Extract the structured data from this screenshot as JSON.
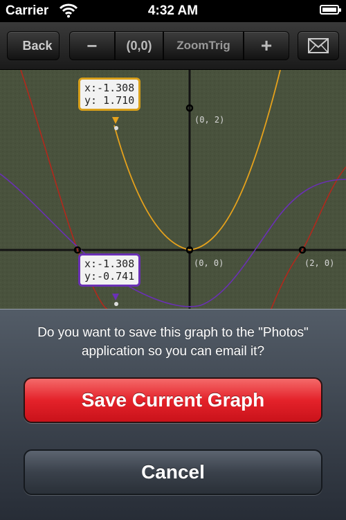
{
  "status_bar": {
    "carrier": "Carrier",
    "time": "4:32 AM"
  },
  "toolbar": {
    "back_label": "Back",
    "zoom_out_label": "−",
    "origin_label": "(0,0)",
    "zoom_trig_label": "ZoomTrig",
    "zoom_in_label": "+",
    "mail_icon": "envelope-icon"
  },
  "graph": {
    "point_labels": {
      "top": "(0, 2)",
      "origin": "(0, 0)",
      "right": "(2, 0)"
    },
    "readout_top": {
      "x": "x:-1.308",
      "y": "y: 1.710"
    },
    "readout_bottom": {
      "x": "x:-1.308",
      "y": "y:-0.741"
    },
    "colors": {
      "background": "#49523d",
      "axis": "#141414",
      "orange_curve": "#e6a21c",
      "purple_curve": "#6a30b5",
      "red_curve": "#b2281c"
    }
  },
  "action_sheet": {
    "message": "Do you want to save this graph to the \"Photos\" application so you can email it?",
    "save_label": "Save Current Graph",
    "cancel_label": "Cancel"
  }
}
